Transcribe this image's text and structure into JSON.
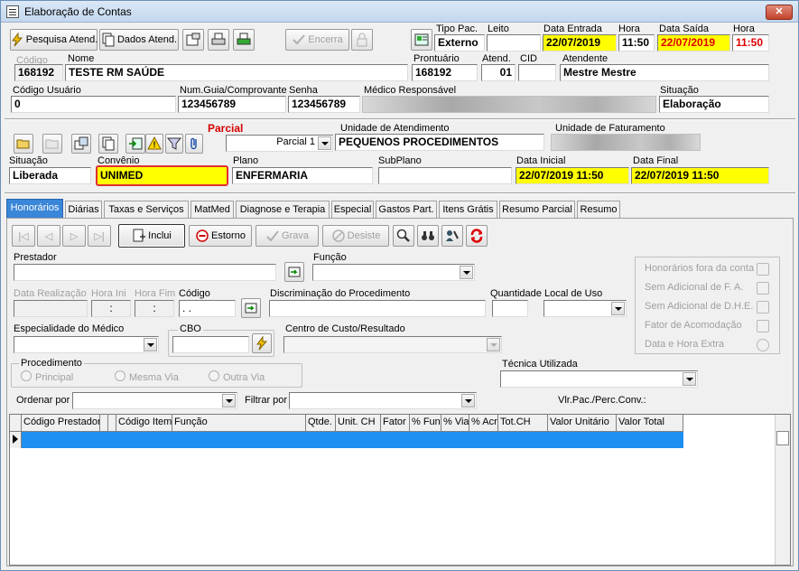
{
  "window": {
    "title": "Elaboração de Contas",
    "close": "✕"
  },
  "toolbar": {
    "pesquisa_label": "Pesquisa Atend.",
    "dados_label": "Dados Atend.",
    "encerra_label": "Encerra"
  },
  "header": {
    "tipo_pac_label": "Tipo Pac.",
    "tipo_pac_value": "Externo",
    "leito_label": "Leito",
    "leito_value": "",
    "data_entrada_label": "Data Entrada",
    "data_entrada_value": "22/07/2019",
    "hora_entrada_label": "Hora",
    "hora_entrada_value": "11:50",
    "data_saida_label": "Data Saída",
    "data_saida_value": "22/07/2019",
    "hora_saida_label": "Hora",
    "hora_saida_value": "11:50",
    "codigo_label": "Código",
    "codigo_value": "168192",
    "nome_label": "Nome",
    "nome_value": "TESTE RM SAÚDE",
    "prontuario_label": "Prontuário",
    "prontuario_value": "168192",
    "atend_label": "Atend.",
    "atend_value": "01",
    "cid_label": "CID",
    "cid_value": "",
    "atendente_label": "Atendente",
    "atendente_value": "Mestre Mestre",
    "codigo_usuario_label": "Código Usuário",
    "codigo_usuario_value": "0",
    "num_guia_label": "Num.Guia/Comprovante",
    "num_guia_value": "123456789",
    "senha_label": "Senha",
    "senha_value": "123456789",
    "medico_label": "Médico Responsável",
    "situacao_label": "Situação",
    "situacao_value": "Elaboração"
  },
  "parcial": {
    "parcial_label": "Parcial",
    "parcial_value": "Parcial 1",
    "unidade_atend_label": "Unidade de Atendimento",
    "unidade_atend_value": "PEQUENOS PROCEDIMENTOS",
    "unidade_fat_label": "Unidade de Faturamento",
    "situacao_label": "Situação",
    "situacao_value": "Liberada",
    "convenio_label": "Convênio",
    "convenio_value": "UNIMED",
    "plano_label": "Plano",
    "plano_value": "ENFERMARIA",
    "subplano_label": "SubPlano",
    "subplano_value": "",
    "data_inicial_label": "Data Inicial",
    "data_inicial_value": "22/07/2019 11:50",
    "data_final_label": "Data Final",
    "data_final_value": "22/07/2019 11:50"
  },
  "tabs": [
    "Honorários",
    "Diárias",
    "Taxas e Serviços",
    "MatMed",
    "Diagnose e Terapia",
    "Especial",
    "Gastos Part.",
    "Itens Grátis",
    "Resumo Parcial",
    "Resumo"
  ],
  "actions": {
    "inclui_label": "Inclui",
    "estorno_label": "Estorno",
    "grava_label": "Grava",
    "desiste_label": "Desiste"
  },
  "form": {
    "prestador_label": "Prestador",
    "funcao_label": "Função",
    "data_realizacao_label": "Data Realização",
    "hora_ini_label": "Hora Ini",
    "hora_ini_value": ":",
    "hora_fim_label": "Hora Fim",
    "hora_fim_value": ":",
    "codigo_label": "Código",
    "codigo_value": ". .",
    "discriminacao_label": "Discriminação do Procedimento",
    "quantidade_label": "Quantidade",
    "local_uso_label": "Local de Uso",
    "especialidade_label": "Especialidade do Médico",
    "cbo_label": "CBO",
    "centro_custo_label": "Centro de Custo/Resultado",
    "procedimento_label": "Procedimento",
    "radio_principal": "Principal",
    "radio_mesma_via": "Mesma Via",
    "radio_outra_via": "Outra Via",
    "tecnica_label": "Técnica Utilizada",
    "ordenar_label": "Ordenar por",
    "filtrar_label": "Filtrar por",
    "vlr_pac_label": "Vlr.Pac./Perc.Conv.:"
  },
  "options": {
    "honorarios_fora": "Honorários fora da conta",
    "sem_adicional_fa": "Sem Adicional de F. A.",
    "sem_adicional_dhe": "Sem Adicional de D.H.E.",
    "fator_acomodacao": "Fator de Acomodação",
    "data_hora_extra": "Data e Hora Extra"
  },
  "grid": {
    "columns": [
      "Código Prestador",
      "",
      "",
      "Código Item",
      "Função",
      "Qtde.",
      "Unit. CH",
      "Fator",
      "% Fun",
      "% Via",
      "% Acr",
      "Tot.CH",
      "Valor Unitário",
      "Valor Total"
    ]
  },
  "colors": {
    "accent": "#1e8ff0",
    "highlight_yellow": "#ffff00",
    "alert_red": "#e00000",
    "tab_active": "#3a86d8"
  }
}
